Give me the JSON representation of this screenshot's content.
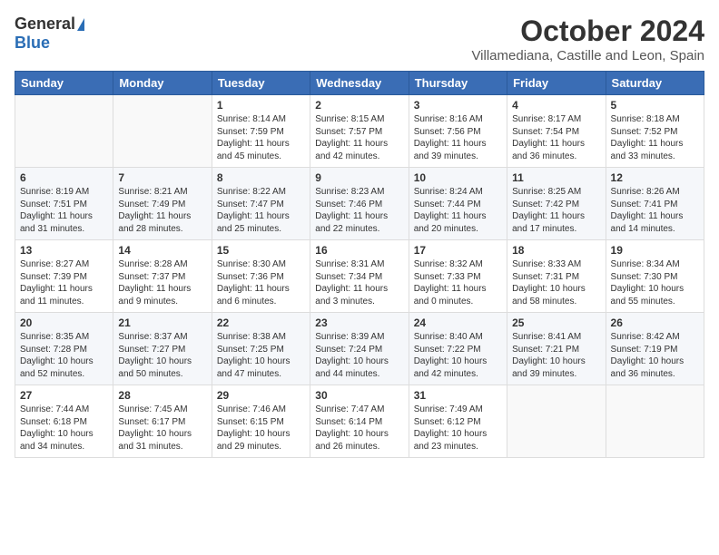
{
  "header": {
    "logo_general": "General",
    "logo_blue": "Blue",
    "month_title": "October 2024",
    "subtitle": "Villamediana, Castille and Leon, Spain"
  },
  "weekdays": [
    "Sunday",
    "Monday",
    "Tuesday",
    "Wednesday",
    "Thursday",
    "Friday",
    "Saturday"
  ],
  "weeks": [
    [
      {
        "day": "",
        "content": ""
      },
      {
        "day": "",
        "content": ""
      },
      {
        "day": "1",
        "content": "Sunrise: 8:14 AM\nSunset: 7:59 PM\nDaylight: 11 hours and 45 minutes."
      },
      {
        "day": "2",
        "content": "Sunrise: 8:15 AM\nSunset: 7:57 PM\nDaylight: 11 hours and 42 minutes."
      },
      {
        "day": "3",
        "content": "Sunrise: 8:16 AM\nSunset: 7:56 PM\nDaylight: 11 hours and 39 minutes."
      },
      {
        "day": "4",
        "content": "Sunrise: 8:17 AM\nSunset: 7:54 PM\nDaylight: 11 hours and 36 minutes."
      },
      {
        "day": "5",
        "content": "Sunrise: 8:18 AM\nSunset: 7:52 PM\nDaylight: 11 hours and 33 minutes."
      }
    ],
    [
      {
        "day": "6",
        "content": "Sunrise: 8:19 AM\nSunset: 7:51 PM\nDaylight: 11 hours and 31 minutes."
      },
      {
        "day": "7",
        "content": "Sunrise: 8:21 AM\nSunset: 7:49 PM\nDaylight: 11 hours and 28 minutes."
      },
      {
        "day": "8",
        "content": "Sunrise: 8:22 AM\nSunset: 7:47 PM\nDaylight: 11 hours and 25 minutes."
      },
      {
        "day": "9",
        "content": "Sunrise: 8:23 AM\nSunset: 7:46 PM\nDaylight: 11 hours and 22 minutes."
      },
      {
        "day": "10",
        "content": "Sunrise: 8:24 AM\nSunset: 7:44 PM\nDaylight: 11 hours and 20 minutes."
      },
      {
        "day": "11",
        "content": "Sunrise: 8:25 AM\nSunset: 7:42 PM\nDaylight: 11 hours and 17 minutes."
      },
      {
        "day": "12",
        "content": "Sunrise: 8:26 AM\nSunset: 7:41 PM\nDaylight: 11 hours and 14 minutes."
      }
    ],
    [
      {
        "day": "13",
        "content": "Sunrise: 8:27 AM\nSunset: 7:39 PM\nDaylight: 11 hours and 11 minutes."
      },
      {
        "day": "14",
        "content": "Sunrise: 8:28 AM\nSunset: 7:37 PM\nDaylight: 11 hours and 9 minutes."
      },
      {
        "day": "15",
        "content": "Sunrise: 8:30 AM\nSunset: 7:36 PM\nDaylight: 11 hours and 6 minutes."
      },
      {
        "day": "16",
        "content": "Sunrise: 8:31 AM\nSunset: 7:34 PM\nDaylight: 11 hours and 3 minutes."
      },
      {
        "day": "17",
        "content": "Sunrise: 8:32 AM\nSunset: 7:33 PM\nDaylight: 11 hours and 0 minutes."
      },
      {
        "day": "18",
        "content": "Sunrise: 8:33 AM\nSunset: 7:31 PM\nDaylight: 10 hours and 58 minutes."
      },
      {
        "day": "19",
        "content": "Sunrise: 8:34 AM\nSunset: 7:30 PM\nDaylight: 10 hours and 55 minutes."
      }
    ],
    [
      {
        "day": "20",
        "content": "Sunrise: 8:35 AM\nSunset: 7:28 PM\nDaylight: 10 hours and 52 minutes."
      },
      {
        "day": "21",
        "content": "Sunrise: 8:37 AM\nSunset: 7:27 PM\nDaylight: 10 hours and 50 minutes."
      },
      {
        "day": "22",
        "content": "Sunrise: 8:38 AM\nSunset: 7:25 PM\nDaylight: 10 hours and 47 minutes."
      },
      {
        "day": "23",
        "content": "Sunrise: 8:39 AM\nSunset: 7:24 PM\nDaylight: 10 hours and 44 minutes."
      },
      {
        "day": "24",
        "content": "Sunrise: 8:40 AM\nSunset: 7:22 PM\nDaylight: 10 hours and 42 minutes."
      },
      {
        "day": "25",
        "content": "Sunrise: 8:41 AM\nSunset: 7:21 PM\nDaylight: 10 hours and 39 minutes."
      },
      {
        "day": "26",
        "content": "Sunrise: 8:42 AM\nSunset: 7:19 PM\nDaylight: 10 hours and 36 minutes."
      }
    ],
    [
      {
        "day": "27",
        "content": "Sunrise: 7:44 AM\nSunset: 6:18 PM\nDaylight: 10 hours and 34 minutes."
      },
      {
        "day": "28",
        "content": "Sunrise: 7:45 AM\nSunset: 6:17 PM\nDaylight: 10 hours and 31 minutes."
      },
      {
        "day": "29",
        "content": "Sunrise: 7:46 AM\nSunset: 6:15 PM\nDaylight: 10 hours and 29 minutes."
      },
      {
        "day": "30",
        "content": "Sunrise: 7:47 AM\nSunset: 6:14 PM\nDaylight: 10 hours and 26 minutes."
      },
      {
        "day": "31",
        "content": "Sunrise: 7:49 AM\nSunset: 6:12 PM\nDaylight: 10 hours and 23 minutes."
      },
      {
        "day": "",
        "content": ""
      },
      {
        "day": "",
        "content": ""
      }
    ]
  ]
}
